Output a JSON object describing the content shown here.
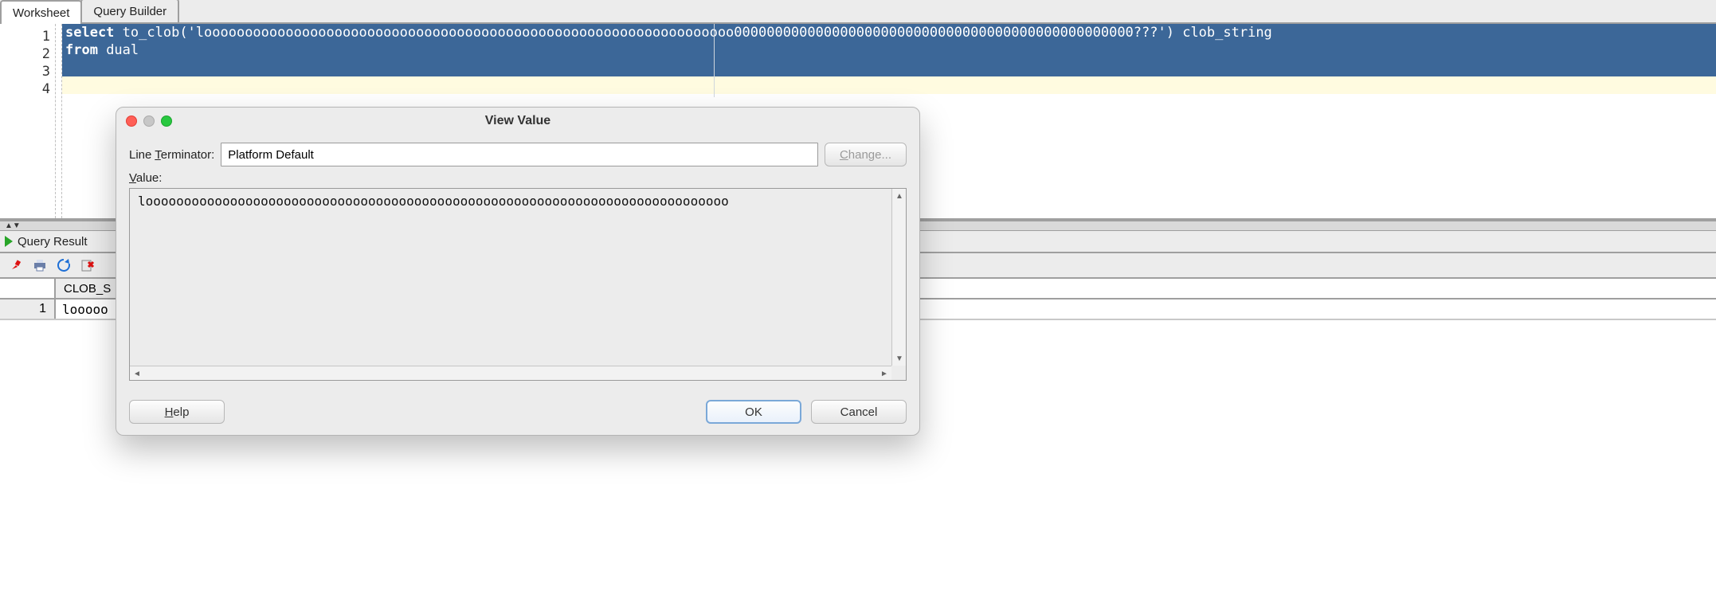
{
  "tabs": {
    "worksheet": "Worksheet",
    "query_builder": "Query Builder"
  },
  "editor": {
    "gutter": [
      "1",
      "2",
      "3",
      "4"
    ],
    "line1_raw": "select to_clob('looooooooooooooooooooooooooooooooooooooooooooooooooooooooooooooooo0000000000000000000000000000000000000000000000000???') clob_string",
    "line1_kw1": "select",
    "line1_func": " to_clob",
    "line1_str": "('looooooooooooooooooooooooooooooooooooooooooooooooooooooooooooooooo0000000000000000000000000000000000000000000000000???')",
    "line1_alias": " clob_string",
    "line2_kw": "from",
    "line2_rest": " dual"
  },
  "results": {
    "tab_label": "Query Result",
    "col1": "CLOB_S",
    "row1_num": "1",
    "row1_val": "looooo"
  },
  "dialog": {
    "title": "View Value",
    "line_terminator_label_pre": "Line ",
    "line_terminator_label_u": "T",
    "line_terminator_label_post": "erminator:",
    "line_terminator_value": "Platform Default",
    "change_u": "C",
    "change_rest": "hange...",
    "value_label_u": "V",
    "value_label_rest": "alue:",
    "value_text": "loooooooooooooooooooooooooooooooooooooooooooooooooooooooooooooooooooooooooooo",
    "help_u": "H",
    "help_rest": "elp",
    "ok": "OK",
    "cancel": "Cancel"
  },
  "icons": {
    "pin": "pin-icon",
    "print": "print-icon",
    "refresh": "refresh-icon",
    "delete": "delete-icon"
  }
}
